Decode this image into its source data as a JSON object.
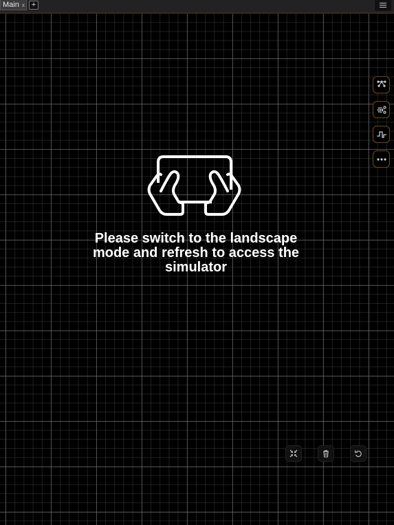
{
  "tabs": [
    {
      "label": "Main",
      "close": "x"
    }
  ],
  "tabbar": {
    "add_label": "+"
  },
  "side_toolbar": {
    "items": [
      {
        "icon": "circuit-components-icon"
      },
      {
        "icon": "settings-gears-icon"
      },
      {
        "icon": "waveform-icon"
      },
      {
        "icon": "more-dots-icon"
      }
    ]
  },
  "message": {
    "text": "Please switch to the landscape mode and refresh to access the simulator"
  },
  "bottom_toolbar": {
    "items": [
      {
        "icon": "fit-screen-icon"
      },
      {
        "icon": "trash-icon"
      },
      {
        "icon": "undo-icon"
      }
    ]
  },
  "colors": {
    "background": "#000000",
    "accent_border": "#6b4a1f",
    "text": "#ffffff"
  }
}
